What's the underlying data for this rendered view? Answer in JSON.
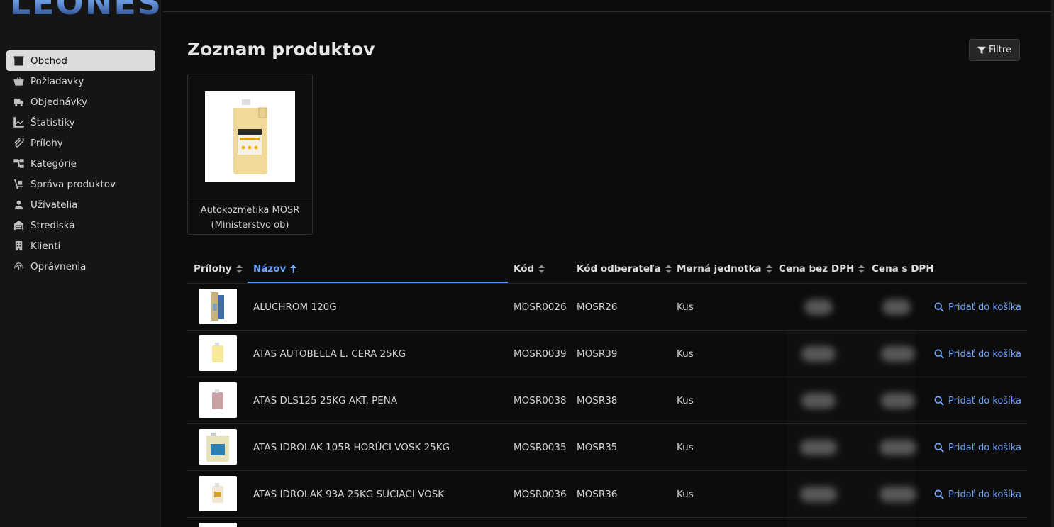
{
  "sidebar": {
    "logo": "LEONESS",
    "items": [
      {
        "label": "Obchod",
        "icon": "store-icon",
        "active": true
      },
      {
        "label": "Požiadavky",
        "icon": "basket-icon"
      },
      {
        "label": "Objednávky",
        "icon": "truck-icon"
      },
      {
        "label": "Štatistiky",
        "icon": "chart-line-icon"
      },
      {
        "label": "Prílohy",
        "icon": "paperclip-icon"
      },
      {
        "label": "Kategórie",
        "icon": "sitemap-icon"
      },
      {
        "label": "Správa produktov",
        "icon": "dolly-icon"
      },
      {
        "label": "Užívatelia",
        "icon": "user-icon"
      },
      {
        "label": "Strediská",
        "icon": "warehouse-icon"
      },
      {
        "label": "Klienti",
        "icon": "building-icon"
      },
      {
        "label": "Oprávnenia",
        "icon": "fingerprint-icon"
      }
    ]
  },
  "header": {
    "title": "Zoznam produktov",
    "filter_label": "Filtre"
  },
  "category": {
    "line1": "Autokozmetika MOSR",
    "line2": "(Ministerstvo ob)"
  },
  "table": {
    "columns": {
      "attachments": "Prílohy",
      "name": "Názov",
      "code": "Kód",
      "customer_code": "Kód odberateľa",
      "unit": "Merná jednotka",
      "price_net": "Cena bez DPH",
      "price_gross": "Cena s DPH"
    },
    "action_label": "Pridať do košíka",
    "rows": [
      {
        "name": "ALUCHROM 120G",
        "code": "MOSR0026",
        "customer_code": "MOSR26",
        "unit": "Kus"
      },
      {
        "name": "ATAS AUTOBELLA L. CERA 25KG",
        "code": "MOSR0039",
        "customer_code": "MOSR39",
        "unit": "Kus"
      },
      {
        "name": "ATAS DLS125 25KG AKT. PENA",
        "code": "MOSR0038",
        "customer_code": "MOSR38",
        "unit": "Kus"
      },
      {
        "name": "ATAS IDROLAK 105R HORÚCI VOSK 25KG",
        "code": "MOSR0035",
        "customer_code": "MOSR35",
        "unit": "Kus"
      },
      {
        "name": "ATAS IDROLAK 93A 25KG SUCIACI VOSK",
        "code": "MOSR0036",
        "customer_code": "MOSR36",
        "unit": "Kus"
      }
    ]
  },
  "colors": {
    "accent": "#6fa6ff",
    "active_nav_bg": "#dcdcdc",
    "background": "#0c0c0c"
  }
}
